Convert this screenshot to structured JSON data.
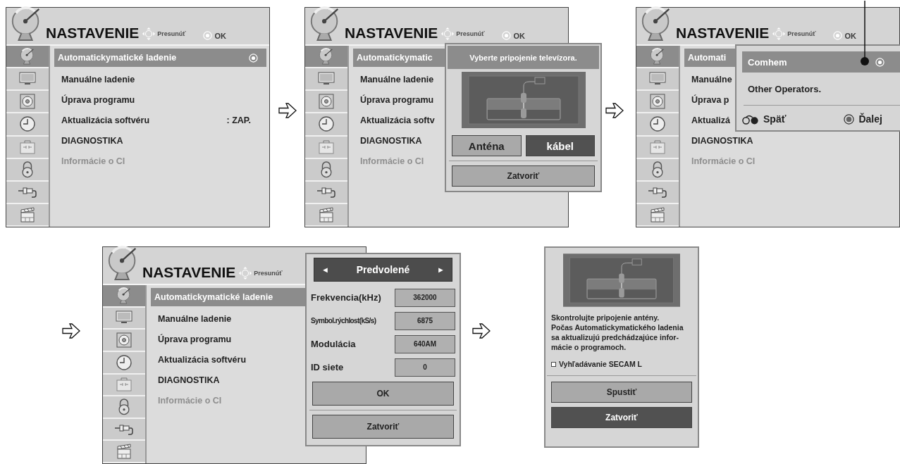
{
  "rows": [
    [
      {
        "kind": "screen",
        "header": {
          "title": "NASTAVENIE",
          "move_label": "Presunúť",
          "ok_label": "OK"
        },
        "sidebar": [
          {
            "selected": true
          },
          {
            "selected": false
          },
          {
            "selected": false
          },
          {
            "selected": false
          },
          {
            "selected": false
          },
          {
            "selected": false
          },
          {
            "selected": false
          },
          {
            "selected": false
          }
        ],
        "menu": [
          {
            "label": "Automatickymatické ladenie",
            "selected": true,
            "disabled": false
          },
          {
            "label": "Manuálne ladenie",
            "selected": false,
            "disabled": false
          },
          {
            "label": "Úprava programu",
            "selected": false,
            "disabled": false
          },
          {
            "label": "Aktualizácia softvéru",
            "value": ": ZAP.",
            "selected": false,
            "disabled": false
          },
          {
            "label": "DIAGNOSTIKA",
            "selected": false,
            "disabled": false
          },
          {
            "label": "Informácie o CI",
            "selected": false,
            "disabled": true
          }
        ]
      },
      {
        "kind": "screen",
        "header": {
          "title": "NASTAVENIE",
          "move_label": "Presunúť",
          "ok_label": "OK"
        },
        "sidebar": [
          {
            "selected": true
          },
          {
            "selected": false
          },
          {
            "selected": false
          },
          {
            "selected": false
          },
          {
            "selected": false
          },
          {
            "selected": false
          },
          {
            "selected": false
          },
          {
            "selected": false
          }
        ],
        "menu": [
          {
            "label": "Automatickymatic",
            "selected": true,
            "disabled": false
          },
          {
            "label": "Manuálne ladenie",
            "selected": false,
            "disabled": false
          },
          {
            "label": "Úprava programu",
            "selected": false,
            "disabled": false
          },
          {
            "label": "Aktualizácia softv",
            "selected": false,
            "disabled": false
          },
          {
            "label": "DIAGNOSTIKA",
            "selected": false,
            "disabled": false
          },
          {
            "label": "Informácie o CI",
            "selected": false,
            "disabled": true
          }
        ],
        "dialog": {
          "kind": "connection",
          "title": "Vyberte pripojenie televízora.",
          "options": [
            {
              "label": "Anténa",
              "selected": false
            },
            {
              "label": "kábel",
              "selected": true
            }
          ],
          "close": "Zatvoriť"
        }
      },
      {
        "kind": "screen",
        "header": {
          "title": "NASTAVENIE",
          "move_label": "Presunúť",
          "ok_label": "OK"
        },
        "sidebar": [
          {
            "selected": true
          },
          {
            "selected": false
          },
          {
            "selected": false
          },
          {
            "selected": false
          },
          {
            "selected": false
          },
          {
            "selected": false
          },
          {
            "selected": false
          },
          {
            "selected": false
          }
        ],
        "menu": [
          {
            "label": "Automati",
            "selected": true,
            "disabled": false
          },
          {
            "label": "Manuálne",
            "selected": false,
            "disabled": false
          },
          {
            "label": "Úprava p",
            "selected": false,
            "disabled": false
          },
          {
            "label": "Aktualizá",
            "selected": false,
            "disabled": false
          },
          {
            "label": "DIAGNOSTIKA",
            "selected": false,
            "disabled": false
          },
          {
            "label": "Informácie o CI",
            "selected": false,
            "disabled": true
          }
        ],
        "dialog": {
          "kind": "operator",
          "options": [
            {
              "label": "Comhem",
              "selected": true
            },
            {
              "label": "Other Operators.",
              "selected": false
            }
          ],
          "back": "Späť",
          "next": "Ďalej"
        }
      }
    ],
    [
      {
        "kind": "screen",
        "header": {
          "title": "NASTAVENIE",
          "move_label": "Presunúť"
        },
        "sidebar": [
          {
            "selected": true
          },
          {
            "selected": false
          },
          {
            "selected": false
          },
          {
            "selected": false
          },
          {
            "selected": false
          },
          {
            "selected": false
          },
          {
            "selected": false
          },
          {
            "selected": false
          }
        ],
        "menu": [
          {
            "label": "Automatickymatické ladenie",
            "selected": true,
            "disabled": false
          },
          {
            "label": "Manuálne ladenie",
            "selected": false,
            "disabled": false
          },
          {
            "label": "Úprava programu",
            "selected": false,
            "disabled": false
          },
          {
            "label": "Aktualizácia softvéru",
            "selected": false,
            "disabled": false
          },
          {
            "label": "DIAGNOSTIKA",
            "selected": false,
            "disabled": false
          },
          {
            "label": "Informácie o CI",
            "selected": false,
            "disabled": true
          }
        ],
        "dialog": {
          "kind": "cable",
          "preset_prev": "◄",
          "preset": "Predvolené",
          "preset_next": "►",
          "fields": [
            {
              "label": "Frekvencia(kHz)",
              "value": "362000"
            },
            {
              "label": "Symbol.rýchlost(kS/s)",
              "value": "6875"
            },
            {
              "label": "Modulácia",
              "value": "640AM"
            },
            {
              "label": "ID siete",
              "value": "0"
            }
          ],
          "ok": "OK",
          "close": "Zatvoriť"
        }
      },
      {
        "kind": "popup",
        "message": [
          "Skontrolujte pripojenie antény.",
          "Počas Automatickymatického ladenia",
          "sa aktualizujú predchádzajúce infor-",
          "mácie o programoch."
        ],
        "option": {
          "label": "Vyhľadávanie SECAM L",
          "checked": false
        },
        "buttons": [
          {
            "label": "Spustiť",
            "selected": false
          },
          {
            "label": "Zatvoriť",
            "selected": true
          }
        ]
      }
    ]
  ]
}
